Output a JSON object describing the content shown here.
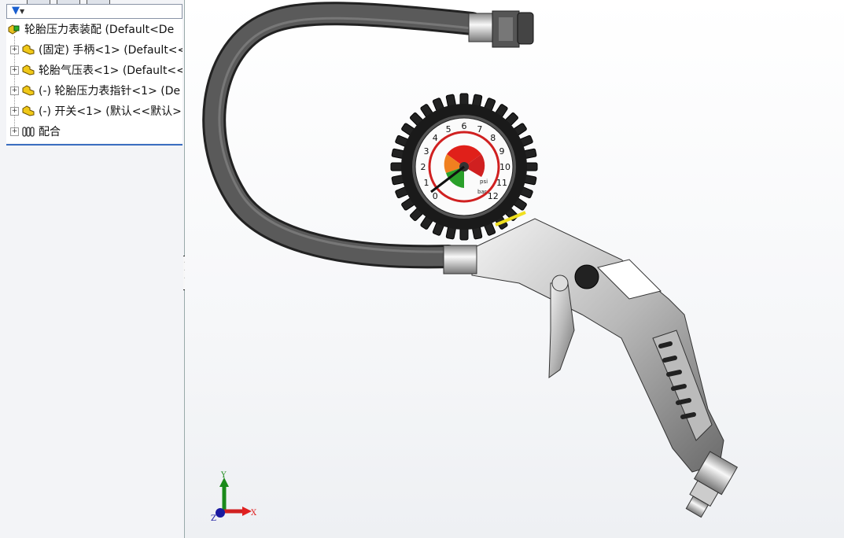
{
  "feature_tree": {
    "filter_icon": "filter-icon",
    "root": {
      "label": "轮胎压力表装配  (Default<De",
      "icon": "assembly-icon"
    },
    "items": [
      {
        "label": "(固定) 手柄<1> (Default<<",
        "icon": "part-icon"
      },
      {
        "label": "轮胎气压表<1> (Default<<",
        "icon": "part-icon"
      },
      {
        "label": "(-) 轮胎压力表指针<1> (De",
        "icon": "part-icon"
      },
      {
        "label": "(-) 开关<1> (默认<<默认>",
        "icon": "part-icon"
      },
      {
        "label": "配合",
        "icon": "mates-icon"
      }
    ]
  },
  "triad": {
    "x": "X",
    "y": "Y",
    "z": "Z"
  },
  "gauge": {
    "bar_ticks": [
      "0",
      "1",
      "2",
      "3",
      "4",
      "5",
      "6",
      "7",
      "8",
      "9",
      "10",
      "11",
      "12"
    ],
    "unit": "bar",
    "unit2": "psi"
  },
  "colors": {
    "tree_accent": "#3a6ec0",
    "x_axis": "#e02020",
    "y_axis": "#1a8a1a",
    "z_axis": "#1a1aa0"
  }
}
